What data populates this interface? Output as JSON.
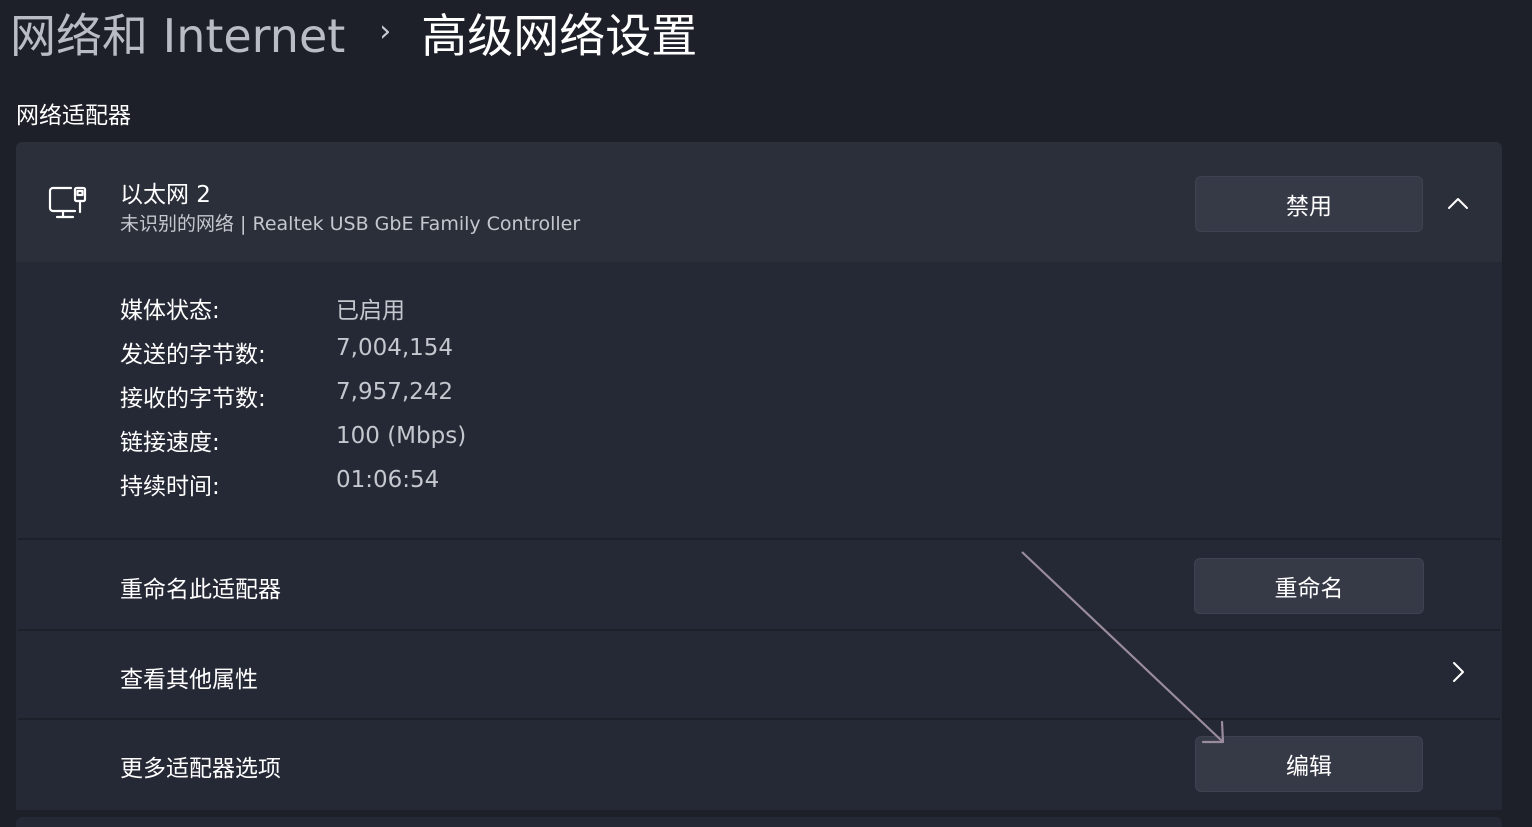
{
  "breadcrumb": {
    "parent": "网络和 Internet",
    "separator": "›",
    "current": "高级网络设置"
  },
  "section_title": "网络适配器",
  "adapter": {
    "icon": "ethernet-computer-icon",
    "name": "以太网 2",
    "description": "未识别的网络 | Realtek USB GbE Family Controller",
    "disable_button": "禁用",
    "expanded": true
  },
  "details": [
    {
      "label": "媒体状态:",
      "value": "已启用"
    },
    {
      "label": "发送的字节数:",
      "value": "7,004,154"
    },
    {
      "label": "接收的字节数:",
      "value": "7,957,242"
    },
    {
      "label": "链接速度:",
      "value": "100 (Mbps)"
    },
    {
      "label": "持续时间:",
      "value": "01:06:54"
    }
  ],
  "rename_row": {
    "label": "重命名此适配器",
    "button": "重命名"
  },
  "properties_row": {
    "label": "查看其他属性",
    "icon": "chevron-right-icon"
  },
  "more_options_row": {
    "label": "更多适配器选项",
    "button": "编辑"
  },
  "colors": {
    "background": "#1d2029",
    "card": "#252935",
    "card_header": "#2b2f3a",
    "button": "#363a47",
    "annotation_arrow": "#9a8c9c"
  }
}
